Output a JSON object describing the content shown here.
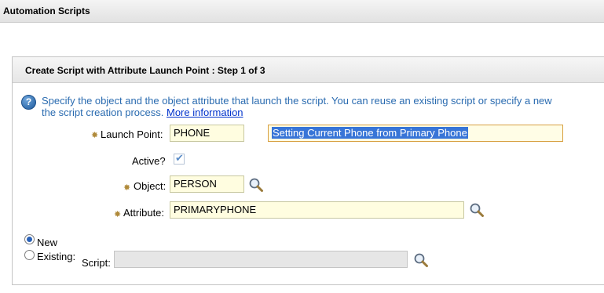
{
  "app": {
    "title": "Automation Scripts"
  },
  "dialog": {
    "title": "Create Script with Attribute Launch Point : Step 1 of 3",
    "instructions_line1": "Specify the object and the object attribute that launch the script. You can reuse an existing script or specify a new",
    "instructions_line2": "the script creation process.",
    "more_link": "More information"
  },
  "form": {
    "launch_point": {
      "label": "Launch Point:",
      "value": "PHONE",
      "description": "Setting Current Phone from Primary Phone"
    },
    "active": {
      "label": "Active?",
      "checked": true
    },
    "object": {
      "label": "Object:",
      "value": "PERSON"
    },
    "attribute": {
      "label": "Attribute:",
      "value": "PRIMARYPHONE"
    }
  },
  "script_choice": {
    "new_label": "New",
    "existing_label": "Existing:",
    "script_label": "Script:",
    "script_value": "",
    "selected": "new"
  },
  "colors": {
    "required_marker": "#b08a3a",
    "link": "#0033cc",
    "instruction_text": "#2a6bb0",
    "field_bg": "#fffde0",
    "selection": "#3875d7"
  },
  "icons": {
    "help": "help-icon",
    "lookup": "magnifier-icon"
  }
}
